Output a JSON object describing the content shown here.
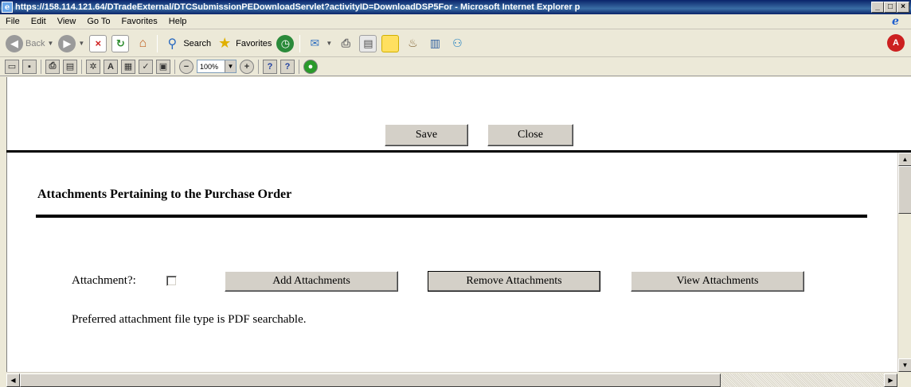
{
  "window": {
    "title": "https://158.114.121.64/DTradeExternal/DTCSubmissionPEDownloadServlet?activityID=DownloadDSP5For - Microsoft Internet Explorer p",
    "minimize": "_",
    "maximize": "□",
    "close": "×"
  },
  "menu": {
    "items": [
      "File",
      "Edit",
      "View",
      "Go To",
      "Favorites",
      "Help"
    ]
  },
  "toolbar": {
    "back_label": "Back",
    "search_label": "Search",
    "favorites_label": "Favorites"
  },
  "doc_toolbar": {
    "zoom_value": "100%"
  },
  "top_frame": {
    "save_label": "Save",
    "close_label": "Close"
  },
  "main": {
    "section_title": "Attachments Pertaining to the Purchase Order",
    "attachment_label": "Attachment?:",
    "attachment_checked": false,
    "add_label": "Add Attachments",
    "remove_label": "Remove Attachments",
    "view_label": "View Attachments",
    "preferred_text": "Preferred attachment file type is PDF searchable."
  },
  "colors": {
    "titlebar": "#0a246a",
    "chrome": "#ece9d8",
    "button_face": "#d4d0c8"
  }
}
